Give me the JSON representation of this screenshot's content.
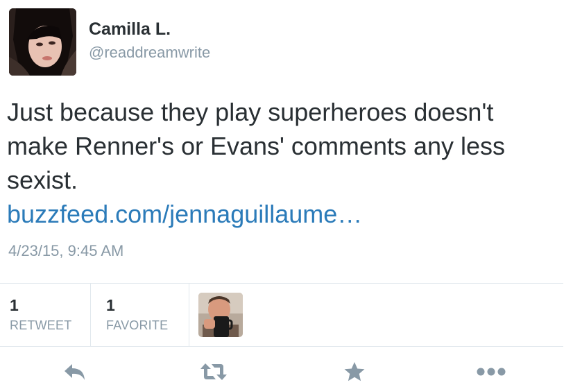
{
  "tweet": {
    "author": {
      "display_name": "Camilla L.",
      "handle": "@readdreamwrite",
      "avatar_icon": "user-avatar-photo"
    },
    "text_lines": [
      "Just because they play superheroes doesn't",
      "make Renner's or Evans' comments any less",
      "sexist."
    ],
    "link": "buzzfeed.com/jennaguillaume…",
    "timestamp": "4/23/15, 9:45 AM",
    "stats": {
      "retweet_count": "1",
      "retweet_label": "RETWEET",
      "favorite_count": "1",
      "favorite_label": "FAVORITE"
    },
    "favoriter_avatar_icon": "favoriter-avatar-photo",
    "actions": [
      {
        "name": "reply-icon"
      },
      {
        "name": "retweet-icon"
      },
      {
        "name": "favorite-star-icon"
      },
      {
        "name": "more-options-icon"
      }
    ]
  },
  "colors": {
    "text": "#292f33",
    "secondary": "#8899a6",
    "link": "#2b7bb9",
    "icon": "#8899a6",
    "divider": "#e1e8ed"
  }
}
